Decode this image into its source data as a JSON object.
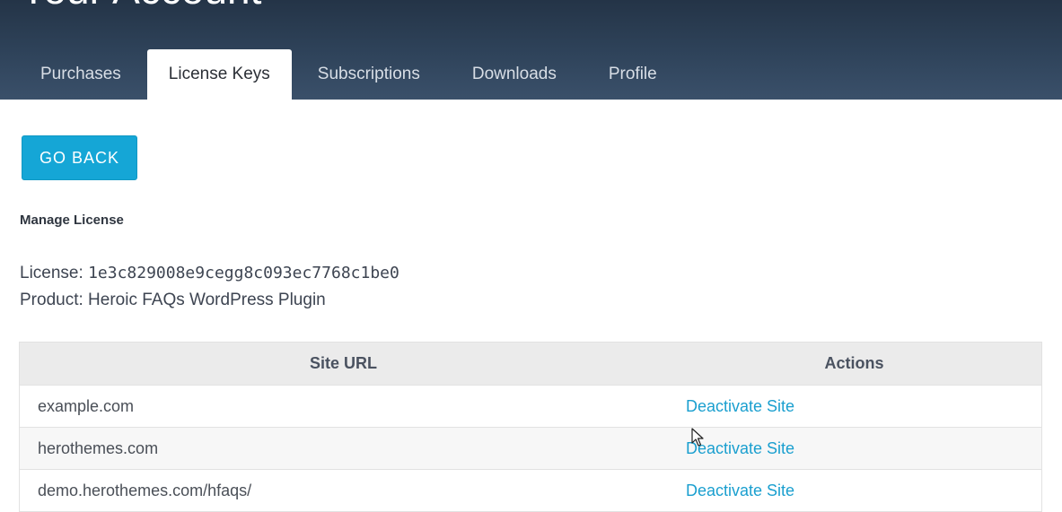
{
  "header": {
    "title": "Your Account",
    "tabs": [
      {
        "label": "Purchases",
        "active": false
      },
      {
        "label": "License Keys",
        "active": true
      },
      {
        "label": "Subscriptions",
        "active": false
      },
      {
        "label": "Downloads",
        "active": false
      },
      {
        "label": "Profile",
        "active": false
      }
    ]
  },
  "main": {
    "go_back_label": "GO BACK",
    "section_title": "Manage License",
    "license_label": "License:",
    "license_key": "1e3c829008e9cegg8c093ec7768c1be0",
    "product_label": "Product:",
    "product_name": "Heroic FAQs WordPress Plugin",
    "table": {
      "columns": [
        "Site URL",
        "Actions"
      ],
      "rows": [
        {
          "url": "example.com",
          "action": "Deactivate Site"
        },
        {
          "url": "herothemes.com",
          "action": "Deactivate Site"
        },
        {
          "url": "demo.herothemes.com/hfaqs/",
          "action": "Deactivate Site"
        }
      ]
    }
  },
  "colors": {
    "header_bg": "#2e4259",
    "accent": "#15a6d6",
    "link": "#1a9fcf"
  }
}
